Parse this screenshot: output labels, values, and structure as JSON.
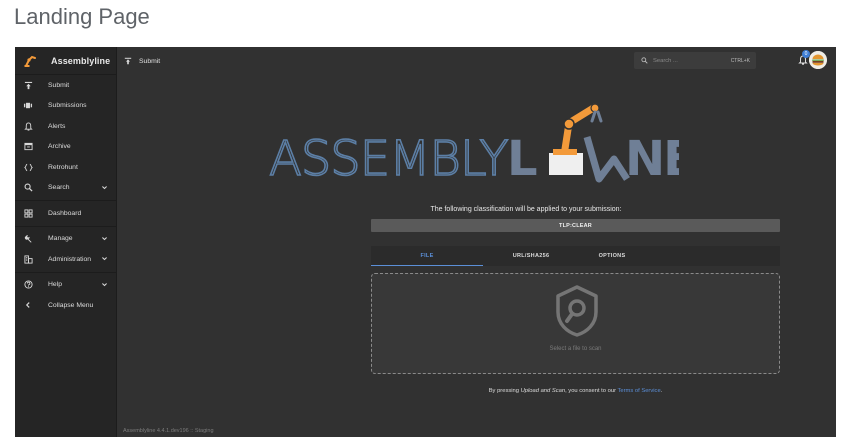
{
  "page": {
    "heading": "Landing Page"
  },
  "sidebar": {
    "brand": "Assemblyline",
    "items": [
      {
        "label": "Submit",
        "icon": "upload-icon",
        "expandable": false
      },
      {
        "label": "Submissions",
        "icon": "submissions-icon",
        "expandable": false
      },
      {
        "label": "Alerts",
        "icon": "bell-icon",
        "expandable": false
      },
      {
        "label": "Archive",
        "icon": "archive-icon",
        "expandable": false
      },
      {
        "label": "Retrohunt",
        "icon": "code-braces-icon",
        "expandable": false
      },
      {
        "label": "Search",
        "icon": "search-icon",
        "expandable": true
      },
      {
        "label": "Dashboard",
        "icon": "dashboard-icon",
        "expandable": false
      },
      {
        "label": "Manage",
        "icon": "wrench-icon",
        "expandable": true
      },
      {
        "label": "Administration",
        "icon": "admin-icon",
        "expandable": true
      },
      {
        "label": "Help",
        "icon": "help-icon",
        "expandable": true
      },
      {
        "label": "Collapse Menu",
        "icon": "chevron-left-icon",
        "expandable": false
      }
    ]
  },
  "topbar": {
    "title": "Submit",
    "search_placeholder": "Search ...",
    "search_shortcut": "CTRL+K",
    "notification_count": "0"
  },
  "main": {
    "logo": {
      "left": "ASSEMBLY",
      "right_pre": "L",
      "right_post": "NE"
    },
    "classification_text": "The following classification will be applied to your submission:",
    "classification_value": "TLP:CLEAR",
    "tabs": [
      {
        "label": "FILE",
        "active": true
      },
      {
        "label": "URL/SHA256",
        "active": false
      },
      {
        "label": "OPTIONS",
        "active": false
      }
    ],
    "dropzone_text": "Select a file to scan",
    "consent_prefix": "By pressing ",
    "consent_action": "Upload and Scan",
    "consent_mid": ", you consent to our ",
    "consent_link": "Terms of Service",
    "consent_suffix": "."
  },
  "footer": {
    "version": "Assemblyline 4.4.1.dev196 :: Staging"
  },
  "colors": {
    "accent": "#5b8fd8",
    "logo_blue": "#5c7fa6",
    "logo_steel": "#6f7f96",
    "logo_orange": "#f39a3a",
    "sidebar_bg": "#252525",
    "main_bg": "#313131"
  }
}
